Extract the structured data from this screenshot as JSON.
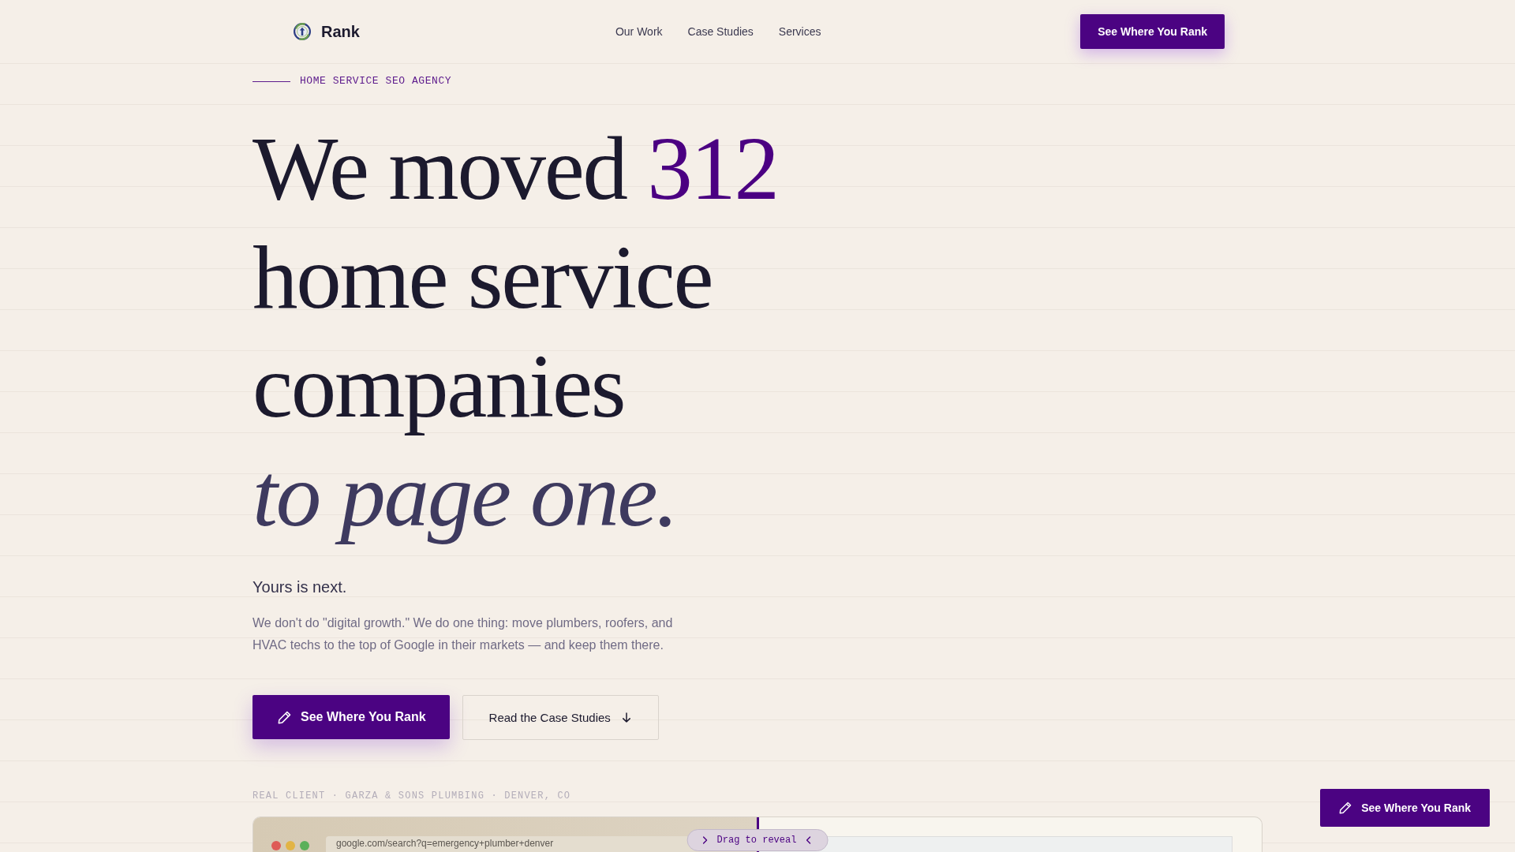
{
  "header": {
    "brand": "Rank",
    "nav": [
      {
        "label": "Our Work"
      },
      {
        "label": "Case Studies"
      },
      {
        "label": "Services"
      }
    ],
    "cta": "See Where You Rank"
  },
  "hero": {
    "eyebrow": "HOME SERVICE SEO AGENCY",
    "headline": {
      "lead": "We moved",
      "highlight": "312",
      "rest": "home service companies",
      "emphasis": "to page one."
    },
    "subheading": "Yours is next.",
    "description": "We don't do \"digital growth.\" We do one thing: move plumbers, roofers, and HVAC techs to the top of Google in their markets — and keep them there.",
    "buttons": [
      {
        "kind": "primary",
        "label": "See Where You Rank"
      },
      {
        "kind": "secondary",
        "label": "Read the Case Studies"
      }
    ]
  },
  "case_preview": {
    "caption": "REAL CLIENT · GARZA & SONS PLUMBING · DENVER, CO",
    "browser": {
      "url": "google.com/search?q=emergency+plumber+denver",
      "handle_label": "Drag to reveal",
      "level": 0.5
    }
  },
  "floating_cta": {
    "label": "See Where You Rank"
  }
}
